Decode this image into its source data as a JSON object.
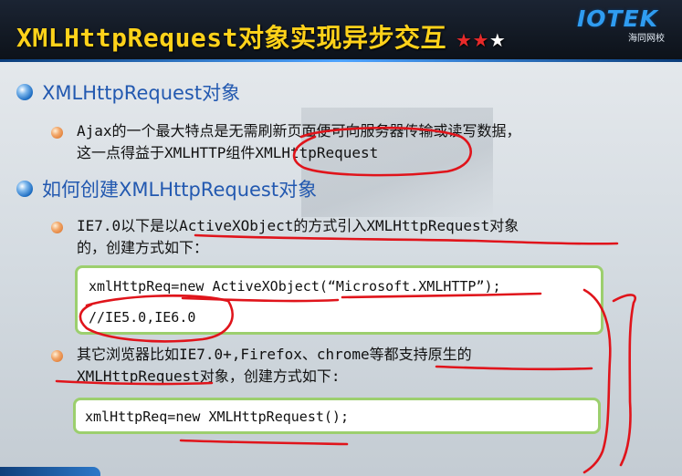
{
  "slide": {
    "title": "XMLHttpRequest对象实现异步交互",
    "stars": {
      "filled": "★★",
      "empty": "★",
      "rating": "2 of 3"
    },
    "logo": {
      "word": "IOTEK",
      "sub": "海同网校"
    },
    "sections": [
      {
        "heading": "XMLHttpRequest对象",
        "bullets": [
          {
            "lines": [
              "Ajax的一个最大特点是无需刷新页面便可向服务器传输或读写数据，",
              "这一点得益于XMLHTTP组件XMLHttpRequest"
            ]
          }
        ]
      },
      {
        "heading": "如何创建XMLHttpRequest对象",
        "bullets": [
          {
            "lines": [
              "IE7.0以下是以ActiveXObject的方式引入XMLHttpRequest对象",
              "的，创建方式如下："
            ]
          },
          {
            "lines": [
              "其它浏览器比如IE7.0+,Firefox、chrome等都支持原生的",
              "XMLHttpRequest对象，创建方式如下:"
            ]
          }
        ]
      }
    ],
    "code_blocks": [
      {
        "lines": [
          "xmlHttpReq=new ActiveXObject(“Microsoft.XMLHTTP”);",
          "//IE5.0,IE6.0"
        ]
      },
      {
        "lines": [
          "xmlHttpReq=new XMLHttpRequest();"
        ]
      }
    ],
    "colors": {
      "title": "#ffd21a",
      "heading": "#2359b0",
      "annotation": "#e0141b",
      "code_border": "#9ccf6e"
    }
  }
}
